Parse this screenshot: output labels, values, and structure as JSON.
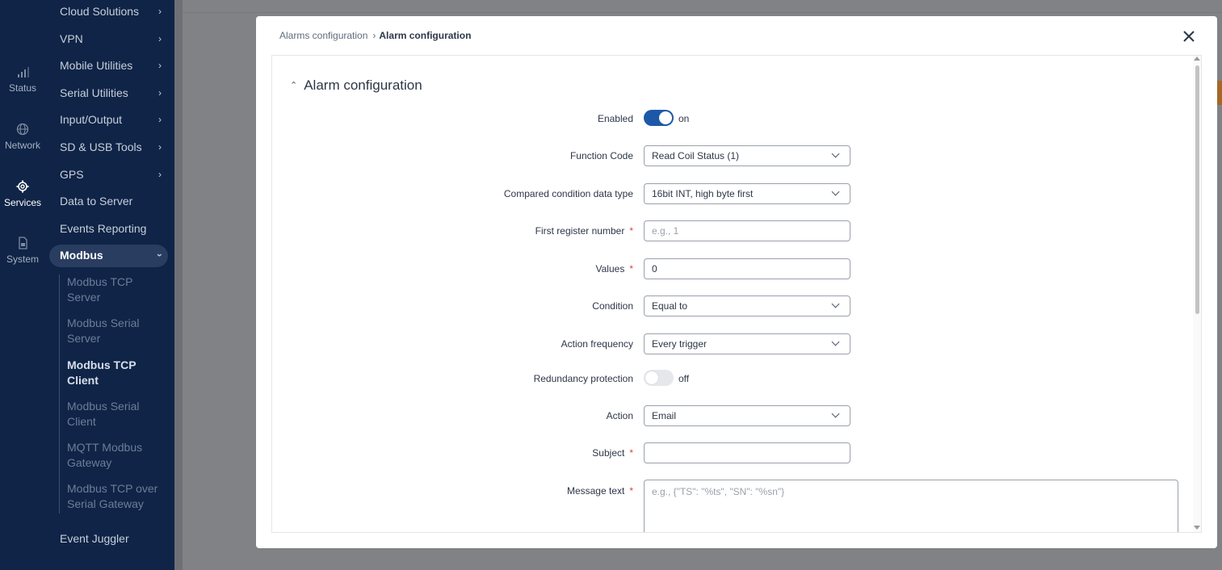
{
  "rail": {
    "items": [
      {
        "label": "Status"
      },
      {
        "label": "Network"
      },
      {
        "label": "Services"
      },
      {
        "label": "System"
      }
    ]
  },
  "menu": {
    "items": [
      {
        "label": "Cloud Solutions"
      },
      {
        "label": "VPN"
      },
      {
        "label": "Mobile Utilities"
      },
      {
        "label": "Serial Utilities"
      },
      {
        "label": "Input/Output"
      },
      {
        "label": "SD & USB Tools"
      },
      {
        "label": "GPS"
      },
      {
        "label": "Data to Server"
      },
      {
        "label": "Events Reporting"
      },
      {
        "label": "Modbus"
      },
      {
        "label": "Event Juggler"
      }
    ],
    "submenu": [
      {
        "label": "Modbus TCP Server"
      },
      {
        "label": "Modbus Serial Server"
      },
      {
        "label": "Modbus TCP Client"
      },
      {
        "label": "Modbus Serial Client"
      },
      {
        "label": "MQTT Modbus Gateway"
      },
      {
        "label": "Modbus TCP over Serial Gateway"
      }
    ]
  },
  "modal": {
    "breadcrumb": [
      "Alarms configuration",
      "Alarm configuration"
    ],
    "section_title": "Alarm configuration",
    "fields": {
      "enabled": {
        "label": "Enabled",
        "state": "on"
      },
      "function_code": {
        "label": "Function Code",
        "value": "Read Coil Status (1)"
      },
      "data_type": {
        "label": "Compared condition data type",
        "value": "16bit INT, high byte first"
      },
      "first_register": {
        "label": "First register number",
        "placeholder": "e.g., 1"
      },
      "values": {
        "label": "Values",
        "value": "0"
      },
      "condition": {
        "label": "Condition",
        "value": "Equal to"
      },
      "action_frequency": {
        "label": "Action frequency",
        "value": "Every trigger"
      },
      "redundancy": {
        "label": "Redundancy protection",
        "state": "off"
      },
      "action": {
        "label": "Action",
        "value": "Email"
      },
      "subject": {
        "label": "Subject",
        "value": ""
      },
      "message": {
        "label": "Message text",
        "placeholder": "e.g., {\"TS\": \"%ts\", \"SN\": \"%sn\"}"
      }
    }
  },
  "colors": {
    "sidebar": "#0f2447",
    "toggle_on": "#1d58a8",
    "required": "#d64545"
  }
}
